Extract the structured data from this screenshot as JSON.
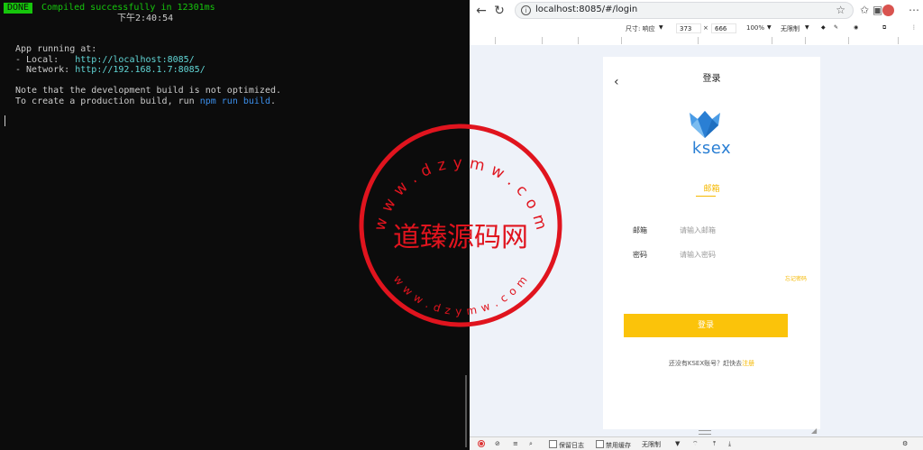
{
  "terminal": {
    "badge": "DONE",
    "compiled": "Compiled successfully in 12301ms",
    "time": "下午2:40:54",
    "app_running": "App running at:",
    "local_label": "- Local:   ",
    "local_url": "http://localhost:8085/",
    "network_label": "- Network: ",
    "network_url": "http://192.168.1.7:8085/",
    "note": "Note that the development build is not optimized.",
    "build_prefix": "To create a production build, run ",
    "build_cmd": "npm run build",
    "build_suffix": "."
  },
  "browser": {
    "url": "localhost:8085/#/login",
    "devbar": {
      "size_label": "尺寸: 响应",
      "width": "373",
      "times": "×",
      "height": "666",
      "zoom": "100%",
      "throttle": "无限制"
    },
    "devtools": {
      "preserve_log": "保留日志",
      "disable_cache": "禁用缓存",
      "throttle": "无限制"
    }
  },
  "login_page": {
    "title": "登录",
    "brand": "ksex",
    "tab_email": "邮箱",
    "email_label": "邮箱",
    "email_placeholder": "请输入邮箱",
    "password_label": "密码",
    "password_placeholder": "请输入密码",
    "forgot": "忘记密码",
    "login_button": "登录",
    "register_prompt": "还没有KSEX账号？赶快去",
    "register_link": "注册"
  },
  "watermark": {
    "center_text": "道臻源码网",
    "top_ring": "w w w . d z y m w . c o m",
    "bottom_ring": "w w w . d z y m w . c o m"
  },
  "colors": {
    "terminal_green": "#16c60c",
    "accent_yellow": "#fbc30a",
    "brand_blue": "#2a7fd4",
    "stamp_red": "#e0141e"
  }
}
